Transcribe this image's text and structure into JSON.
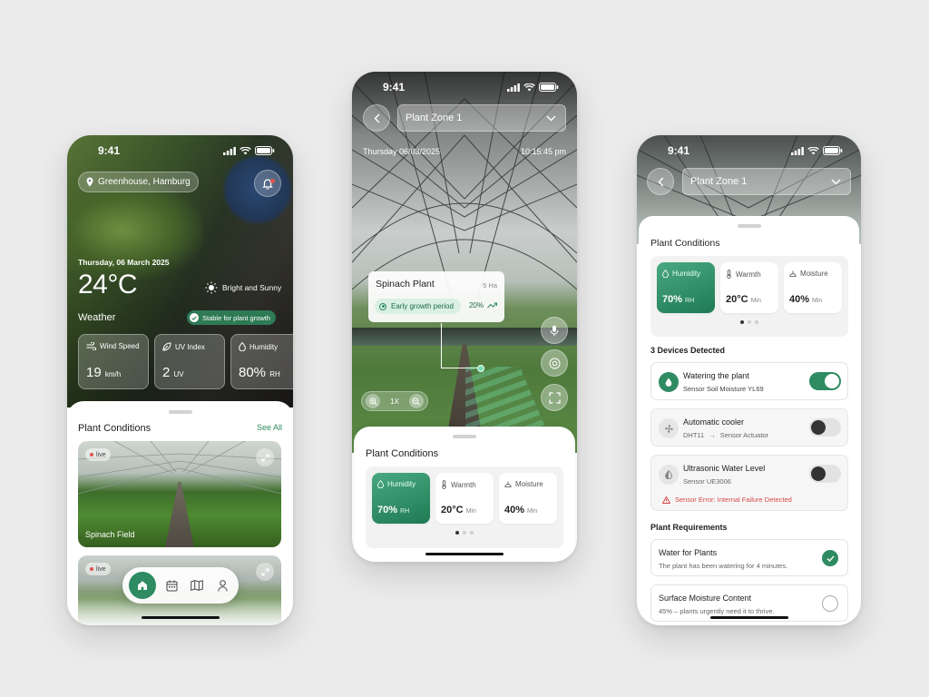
{
  "status_time": "9:41",
  "colors": {
    "accent": "#2e8b62",
    "error": "#d94848",
    "background": "#ebebeb"
  },
  "phone1": {
    "location": "Greenhouse, Hamburg",
    "date": "Thursday, 06 March 2025",
    "temperature": "24°C",
    "weather_label": "Weather",
    "weather_desc": "Bright and Sunny",
    "stable_badge": "Stable for plant growth",
    "stats": [
      {
        "icon": "wind-icon",
        "label": "Wind Speed",
        "value": "19",
        "unit": "km/h"
      },
      {
        "icon": "sun-icon",
        "label": "UV Index",
        "value": "2",
        "unit": "UV"
      },
      {
        "icon": "drop-icon",
        "label": "Humidity",
        "value": "80%",
        "unit": "RH"
      }
    ],
    "sheet_title": "Plant Conditions",
    "see_all": "See All",
    "cards": [
      {
        "live": "live",
        "title": "Spinach Field"
      },
      {
        "live": "live",
        "title": ""
      }
    ],
    "nav": [
      "home-icon",
      "calendar-icon",
      "map-icon",
      "user-icon"
    ]
  },
  "phone2": {
    "zone": "Plant Zone 1",
    "date": "Thursday 06/03/2025",
    "time": "10:15:45 pm",
    "plant_name": "Spinach Plant",
    "plant_area": "5 Ha",
    "growth_stage": "Early growth period",
    "growth_pct": "20%",
    "zoom": "1X",
    "sheet_title": "Plant Conditions",
    "conditions": [
      {
        "label": "Humidity",
        "value": "70%",
        "unit": "RH",
        "active": true
      },
      {
        "label": "Warmth",
        "value": "20°C",
        "unit": "Min",
        "active": false
      },
      {
        "label": "Moisture",
        "value": "40%",
        "unit": "Min",
        "active": false
      }
    ]
  },
  "phone3": {
    "zone": "Plant Zone 1",
    "sheet_title": "Plant Conditions",
    "conditions": [
      {
        "label": "Humidity",
        "value": "70%",
        "unit": "RH",
        "active": true
      },
      {
        "label": "Warmth",
        "value": "20°C",
        "unit": "Min",
        "active": false
      },
      {
        "label": "Moisture",
        "value": "40%",
        "unit": "Min",
        "active": false
      }
    ],
    "devices_title": "3 Devices Detected",
    "devices": [
      {
        "name": "Watering the plant",
        "sub": "Sensor Soil Moisture YL69",
        "on": true
      },
      {
        "name": "Automatic cooler",
        "sub_from": "DHT11",
        "sub_arrow": "→",
        "sub_to": "Sensor Actuator",
        "on": false
      },
      {
        "name": "Ultrasonic Water Level",
        "sub": "Sensor UE3006",
        "on": false,
        "error": "Sensor Error: Internal Failure Detected"
      }
    ],
    "req_title": "Plant Requirements",
    "requirements": [
      {
        "title": "Water for Plants",
        "desc": "The plant has been watering for 4 minutes.",
        "done": true
      },
      {
        "title": "Surface Moisture Content",
        "desc": "45% – plants urgently need it to thrive.",
        "done": false
      }
    ]
  }
}
